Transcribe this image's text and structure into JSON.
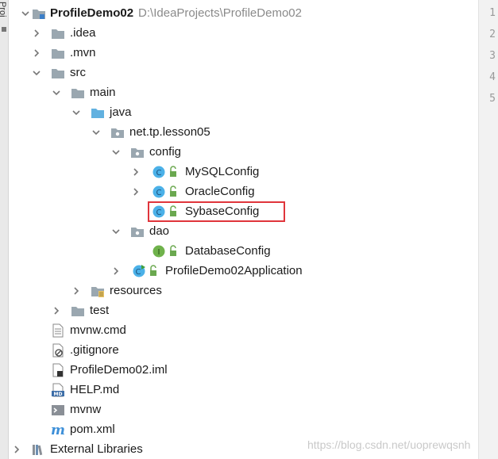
{
  "side_tab": {
    "label": "Proj"
  },
  "gutter": {
    "line_numbers": [
      "1",
      "2",
      "3",
      "4",
      "5"
    ]
  },
  "tree": {
    "root": {
      "name": "ProfileDemo02",
      "path": "D:\\IdeaProjects\\ProfileDemo02"
    },
    "nodes": [
      {
        "label": "ProfileDemo02"
      },
      {
        "label": ".idea"
      },
      {
        "label": ".mvn"
      },
      {
        "label": "src"
      },
      {
        "label": "main"
      },
      {
        "label": "java"
      },
      {
        "label": "net.tp.lesson05"
      },
      {
        "label": "config"
      },
      {
        "label": "MySQLConfig"
      },
      {
        "label": "OracleConfig"
      },
      {
        "label": "SybaseConfig"
      },
      {
        "label": "dao"
      },
      {
        "label": "DatabaseConfig"
      },
      {
        "label": "ProfileDemo02Application"
      },
      {
        "label": "resources"
      },
      {
        "label": "test"
      },
      {
        "label": "mvnw.cmd"
      },
      {
        "label": ".gitignore"
      },
      {
        "label": "ProfileDemo02.iml"
      },
      {
        "label": "HELP.md"
      },
      {
        "label": "mvnw"
      },
      {
        "label": "pom.xml"
      },
      {
        "label": "External Libraries"
      }
    ]
  },
  "colors": {
    "folder": "#9aa7b0",
    "source_folder": "#62b1e0",
    "class_icon": "#4bb1e8",
    "interface_icon": "#6fb24b",
    "lock": "#6aa84f",
    "highlight": "#e0353b",
    "maven_blue": "#3d8fd8"
  },
  "watermark": "https://blog.csdn.net/uoprewqsnh"
}
